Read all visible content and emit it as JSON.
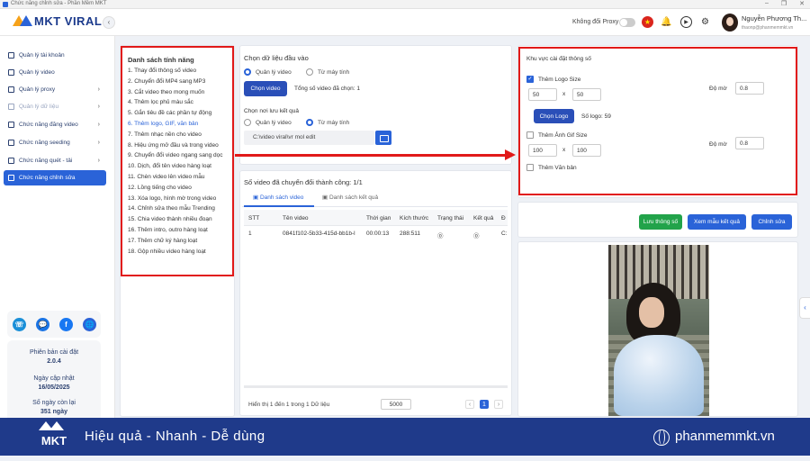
{
  "window": {
    "title": "Chức năng chỉnh sửa - Phần Mềm MKT",
    "min": "–",
    "max": "❐",
    "close": "✕"
  },
  "topbar": {
    "logo_text": "MKT VIRAL",
    "collapse_icon": "‹",
    "proxy_label": "Không đổi Proxy",
    "flag_star": "★",
    "bell_icon": "🔔",
    "play_icon": "▶",
    "settings_icon": "⚙",
    "user_name": "Nguyễn Phương Th...",
    "user_email": "thaonp@phanmemmkt.vn"
  },
  "sidebar": {
    "items": [
      {
        "label": "Quản lý tài khoản"
      },
      {
        "label": "Quản lý video"
      },
      {
        "label": "Quản lý proxy",
        "chevron": "›"
      },
      {
        "label": "Quản lý dữ liệu",
        "chevron": "›"
      },
      {
        "label": "Chức năng đăng video",
        "chevron": "›"
      },
      {
        "label": "Chức năng seeding",
        "chevron": "›"
      },
      {
        "label": "Chức năng quét - tải",
        "chevron": "›"
      },
      {
        "label": "Chức năng chỉnh sửa"
      }
    ],
    "social": [
      "☏",
      "💬",
      "f",
      "🌐"
    ],
    "info": [
      {
        "label": "Phiên bản cài đặt",
        "value": "2.0.4"
      },
      {
        "label": "Ngày cập nhật",
        "value": "16/05/2025"
      },
      {
        "label": "Số ngày còn lại",
        "value": "351 ngày"
      }
    ]
  },
  "features": {
    "title": "Danh sách tính năng",
    "items": [
      "1. Thay đổi thông số video",
      "2. Chuyển đổi MP4 sang MP3",
      "3. Cắt video theo mong muốn",
      "4. Thêm lọc phủ màu sắc",
      "5. Gắn tiêu đề các phần tự động",
      "6. Thêm logo, GIF, văn bản",
      "7. Thêm nhạc nền cho video",
      "8. Hiệu ứng mở đầu và trong video",
      "9. Chuyển đổi video ngang sang dọc",
      "10. Dịch, đổi tên video hàng loạt",
      "11. Chèn video lên video mẫu",
      "12. Lồng tiếng cho video",
      "13. Xóa logo, hình mờ trong video",
      "14. Chỉnh sửa theo mẫu Trending",
      "15. Chia video thành nhiều đoạn",
      "16. Thêm intro, outro hàng loạt",
      "17. Thêm chữ ký hàng loạt",
      "18. Gộp nhiều video hàng loạt"
    ],
    "selected_index": 5
  },
  "input_section": {
    "title": "Chọn dữ liệu đầu vào",
    "option1": "Quản lý video",
    "option2": "Từ máy tính",
    "choose_btn": "Chọn video",
    "total_label": "Tổng số video đã chọn: 1",
    "save_title": "Chọn nơi lưu kết quả",
    "save_option1": "Quản lý video",
    "save_option2": "Từ máy tính",
    "save_path": "C:\\video viral\\vr mol edit"
  },
  "results": {
    "title": "Số video đã chuyển đổi thành công: 1/1",
    "tab1": "Danh sách video",
    "tab2": "Danh sách kết quả",
    "columns": [
      "STT",
      "Tên video",
      "Thời gian",
      "Kích thước",
      "Trạng thái",
      "Kết quả",
      "Đ"
    ],
    "rows": [
      {
        "stt": "1",
        "name": "0841f102-5b33-415d-bb1b-l",
        "time": "00:00:13",
        "size": "288:511",
        "status": "⓪",
        "result": "⓪",
        "extra": "C:"
      }
    ],
    "footer": "Hiển thị 1 đến 1 trong 1 Dữ liệu",
    "page_size": "5000",
    "prev": "‹",
    "page": "1",
    "next": "›"
  },
  "settings": {
    "title": "Khu vực cài đặt thông số",
    "logo_size_label": "Thêm Logo Size",
    "logo_w": "50",
    "logo_h": "50",
    "x_label": "x",
    "opacity_label": "Độ mờ",
    "logo_opacity": "0.8",
    "choose_logo_btn": "Chọn Logo",
    "logo_count": "Số logo: 59",
    "gif_size_label": "Thêm Ảnh Gif Size",
    "gif_w": "100",
    "gif_h": "100",
    "gif_opacity": "0.8",
    "text_label": "Thêm Văn bản",
    "check": "✓"
  },
  "actions": {
    "save": "Lưu thông số",
    "preview": "Xem mẫu kết quả",
    "edit": "Chỉnh sửa"
  },
  "side_tab": "‹",
  "footer_banner": {
    "brand": "MKT",
    "slogan": "Hiệu quả - Nhanh - Dễ dùng",
    "website": "phanmemmkt.vn"
  }
}
